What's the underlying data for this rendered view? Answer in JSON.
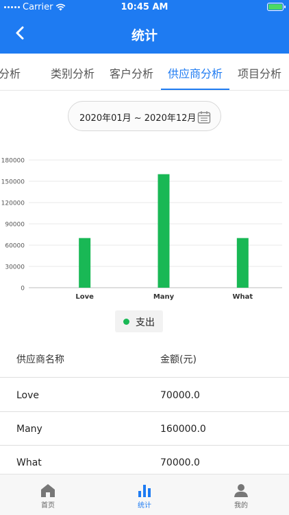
{
  "status_bar": {
    "carrier": "Carrier",
    "time": "10:45 AM"
  },
  "nav": {
    "title": "统计"
  },
  "tabs": [
    {
      "label": "收支分析"
    },
    {
      "label": "类别分析"
    },
    {
      "label": "客户分析"
    },
    {
      "label": "供应商分析"
    },
    {
      "label": "项目分析"
    }
  ],
  "active_tab": 3,
  "date_range": "2020年01月 ~ 2020年12月",
  "chart_data": {
    "type": "bar",
    "categories": [
      "Love",
      "Many",
      "What"
    ],
    "series": [
      {
        "name": "支出",
        "values": [
          70000,
          160000,
          70000
        ]
      }
    ],
    "ylim": [
      0,
      180000
    ],
    "yticks": [
      0,
      30000,
      60000,
      90000,
      120000,
      150000,
      180000
    ],
    "grid": true,
    "color": "#19b855",
    "legend_position": "bottom"
  },
  "legend_label": "支出",
  "table": {
    "headers": [
      "供应商名称",
      "金额(元)"
    ],
    "rows": [
      [
        "Love",
        "70000.0"
      ],
      [
        "Many",
        "160000.0"
      ],
      [
        "What",
        "70000.0"
      ]
    ]
  },
  "tabbar": [
    {
      "label": "首页",
      "icon": "home-icon"
    },
    {
      "label": "统计",
      "icon": "bar-chart-icon"
    },
    {
      "label": "我的",
      "icon": "user-icon"
    }
  ],
  "colors": {
    "primary": "#1e7bf2",
    "bar": "#19b855"
  }
}
